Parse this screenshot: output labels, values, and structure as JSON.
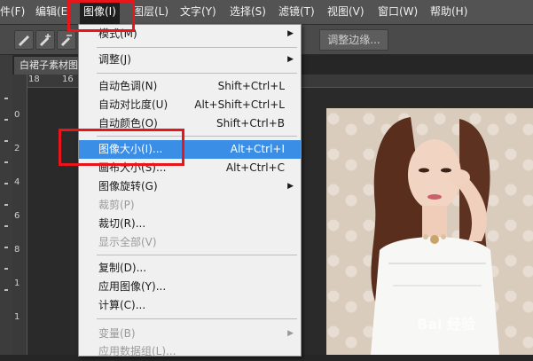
{
  "menubar": {
    "items": [
      "件(F)",
      "编辑(E",
      "图像(I)",
      "图层(L)",
      "文字(Y)",
      "选择(S)",
      "滤镜(T)",
      "视图(V)",
      "窗口(W)",
      "帮助(H)"
    ]
  },
  "options_bar": {
    "refine_edge_label": "调整边缘..."
  },
  "document": {
    "tab_title": "白裙子素材图"
  },
  "rulers": {
    "top": [
      "18",
      "16"
    ],
    "left": [
      "0",
      "2",
      "4",
      "6",
      "8",
      "1",
      "1"
    ]
  },
  "image_menu": {
    "items": [
      {
        "label": "模式(M)",
        "shortcut": "",
        "submenu": true,
        "disabled": false,
        "highlighted": false
      },
      {
        "label": "调整(J)",
        "shortcut": "",
        "submenu": true,
        "disabled": false,
        "highlighted": false
      },
      {
        "label": "自动色调(N)",
        "shortcut": "Shift+Ctrl+L",
        "submenu": false,
        "disabled": false,
        "highlighted": false
      },
      {
        "label": "自动对比度(U)",
        "shortcut": "Alt+Shift+Ctrl+L",
        "submenu": false,
        "disabled": false,
        "highlighted": false
      },
      {
        "label": "自动颜色(O)",
        "shortcut": "Shift+Ctrl+B",
        "submenu": false,
        "disabled": false,
        "highlighted": false
      },
      {
        "label": "图像大小(I)...",
        "shortcut": "Alt+Ctrl+I",
        "submenu": false,
        "disabled": false,
        "highlighted": true
      },
      {
        "label": "画布大小(S)...",
        "shortcut": "Alt+Ctrl+C",
        "submenu": false,
        "disabled": false,
        "highlighted": false
      },
      {
        "label": "图像旋转(G)",
        "shortcut": "",
        "submenu": true,
        "disabled": false,
        "highlighted": false
      },
      {
        "label": "裁剪(P)",
        "shortcut": "",
        "submenu": false,
        "disabled": true,
        "highlighted": false
      },
      {
        "label": "裁切(R)...",
        "shortcut": "",
        "submenu": false,
        "disabled": false,
        "highlighted": false
      },
      {
        "label": "显示全部(V)",
        "shortcut": "",
        "submenu": false,
        "disabled": true,
        "highlighted": false
      },
      {
        "label": "复制(D)...",
        "shortcut": "",
        "submenu": false,
        "disabled": false,
        "highlighted": false
      },
      {
        "label": "应用图像(Y)...",
        "shortcut": "",
        "submenu": false,
        "disabled": false,
        "highlighted": false
      },
      {
        "label": "计算(C)...",
        "shortcut": "",
        "submenu": false,
        "disabled": false,
        "highlighted": false
      },
      {
        "label": "变量(B)",
        "shortcut": "",
        "submenu": true,
        "disabled": true,
        "highlighted": false
      },
      {
        "label": "应用数据组(L)...",
        "shortcut": "",
        "submenu": false,
        "disabled": true,
        "highlighted": false
      }
    ]
  },
  "watermark": "Bai 经验",
  "colors": {
    "highlight": "#3a8ee6",
    "annotation_red": "#e8161b",
    "menu_bg": "#f0f0f0"
  }
}
